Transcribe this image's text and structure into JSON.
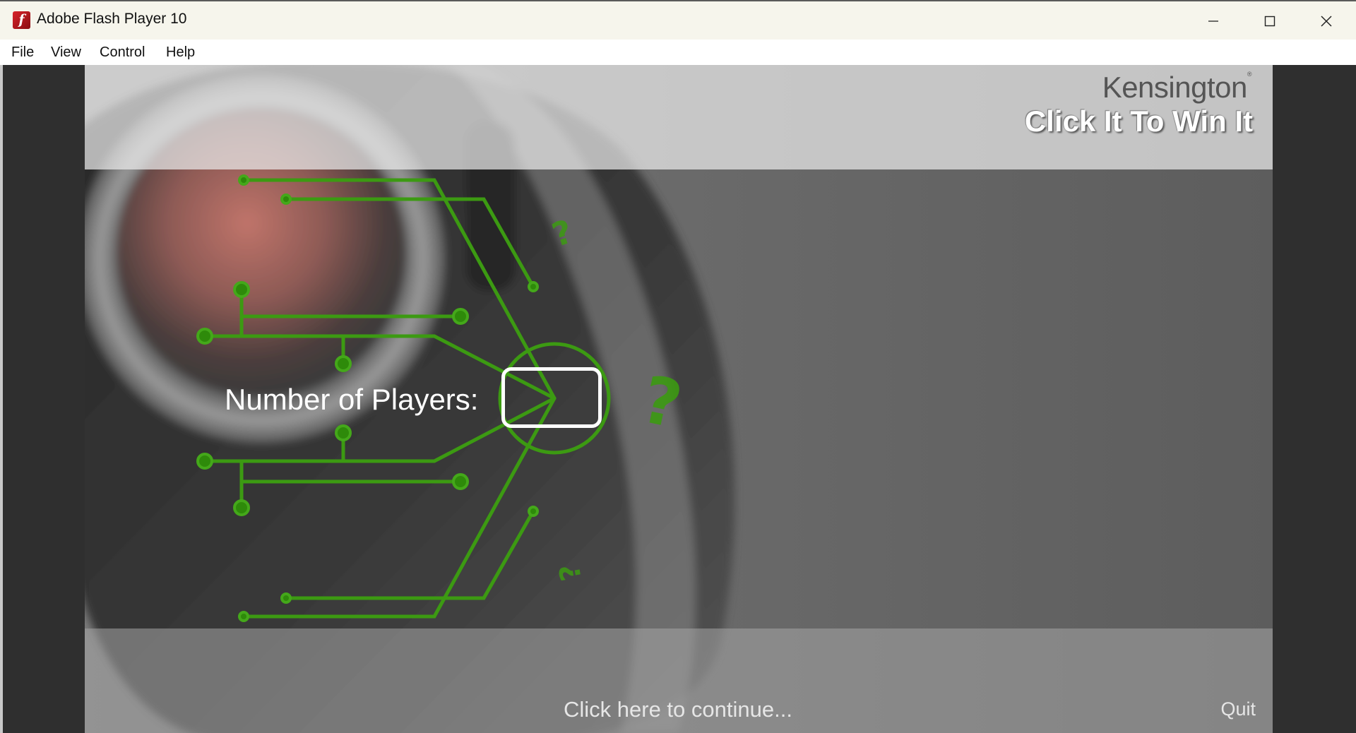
{
  "window": {
    "title": "Adobe Flash Player 10",
    "icon": "flash-icon",
    "icon_glyph": "f"
  },
  "menu": {
    "items": [
      {
        "label": "File"
      },
      {
        "label": "View"
      },
      {
        "label": "Control"
      },
      {
        "label": "Help"
      }
    ]
  },
  "stage": {
    "brand": "Kensington",
    "brand_mark": "®",
    "slogan": "Click It To Win It",
    "players_label": "Number of Players:",
    "players_value": "",
    "continue_label": "Click here to continue...",
    "quit_label": "Quit"
  },
  "colors": {
    "accent_green": "#3c9a12",
    "titlebar": "#f6f5ec",
    "flash_red": "#d8232a"
  }
}
